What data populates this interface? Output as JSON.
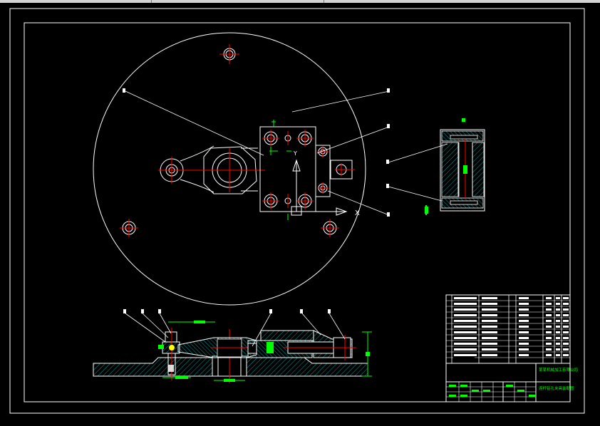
{
  "title_block": {
    "company_label": "某某机械加工有限公司",
    "drawing_name": "连杆钻孔夹具装配图"
  },
  "labels": {
    "x_axis": "X",
    "y_axis": "Y"
  },
  "colors": {
    "background": "#000000",
    "line": "#ffffff",
    "center_line": "#ff0000",
    "dimension": "#00ff00",
    "hatch": "#00c8c8",
    "note": "#ffff00"
  }
}
